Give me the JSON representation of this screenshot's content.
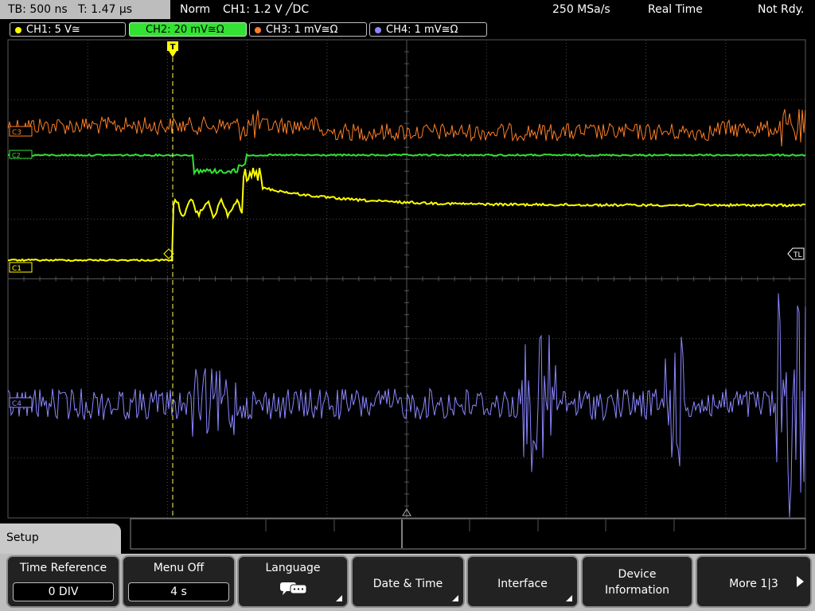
{
  "status": {
    "timebase": "TB: 500 ns",
    "trigger_time": "T: 1.47 µs",
    "mode": "Norm",
    "trigger": "CH1: 1.2 V ╱DC",
    "sample_rate": "250 MSa/s",
    "acquisition": "Real Time",
    "state": "Not Rdy."
  },
  "channels": [
    {
      "label": "CH1: 5 V≅",
      "color": "#ffff00"
    },
    {
      "label": "CH2: 20 mV≅Ω",
      "color": "#33e233",
      "active": true
    },
    {
      "label": "CH3: 1 mV≅Ω",
      "color": "#ff7f27"
    },
    {
      "label": "CH4: 1 mV≅Ω",
      "color": "#8b86ff"
    }
  ],
  "markers": {
    "ch1": "C1",
    "ch2": "C2",
    "ch3": "C3",
    "ch4": "C4",
    "trigger_level": "TL",
    "trigger_point": "T"
  },
  "menu": {
    "title": "Setup",
    "keys": [
      {
        "label": "Time Reference",
        "value": "0 DIV"
      },
      {
        "label": "Menu Off",
        "value": "4 s"
      },
      {
        "label": "Language",
        "icon": "speech-bubble-icon"
      },
      {
        "label": "Date & Time"
      },
      {
        "label": "Interface"
      },
      {
        "label": "Device Information"
      },
      {
        "label": "More 1|3"
      }
    ]
  },
  "colors": {
    "ch1": "#ffff00",
    "ch2": "#33e233",
    "ch3": "#ff7f27",
    "ch4": "#8b86ff",
    "grid": "#4a4a4a",
    "bezel": "#bdbdbd"
  }
}
